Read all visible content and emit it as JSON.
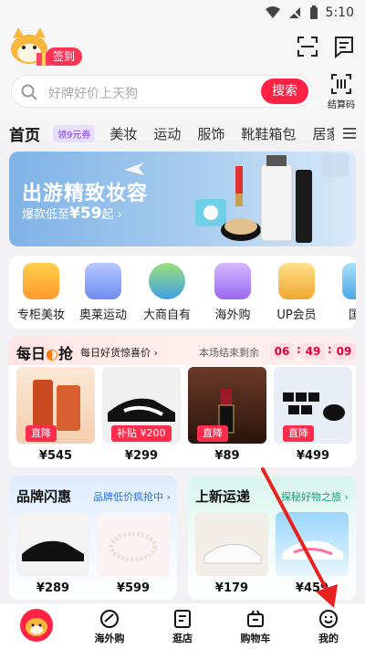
{
  "status": {
    "time": "5:10"
  },
  "header": {
    "signin_label": "签到",
    "search_placeholder": "好牌好价上天狗",
    "search_button": "搜索",
    "paycode_label": "结算码"
  },
  "tabs": {
    "items": [
      "首页",
      "美妆",
      "运动",
      "服饰",
      "靴鞋箱包",
      "居家"
    ],
    "badge": "领9元券"
  },
  "banner": {
    "title": "出游精致妆容",
    "sub_prefix": "爆款低至",
    "sub_price": "¥59",
    "sub_suffix": "起"
  },
  "entries": [
    "专柜美妆",
    "奥莱运动",
    "大商自有",
    "海外购",
    "UP会员",
    "国补"
  ],
  "flash": {
    "title": "每日",
    "title_suffix": "抢",
    "subtitle": "每日好货惊喜价",
    "ends_label": "本场结束剩余",
    "countdown": [
      "06",
      "49",
      "09"
    ],
    "products": [
      {
        "price": "¥545",
        "tag": "直降"
      },
      {
        "price": "¥299",
        "tag": "补贴 ¥200"
      },
      {
        "price": "¥89",
        "tag": "直降"
      },
      {
        "price": "¥499",
        "tag": "直降"
      }
    ]
  },
  "cards": [
    {
      "title": "品牌闪惠",
      "subtitle": "品牌低价疯抢中",
      "prices": [
        "¥289",
        "¥599"
      ]
    },
    {
      "title": "上新运递",
      "subtitle": "探秘好物之旅",
      "prices": [
        "¥179",
        "¥459"
      ]
    }
  ],
  "bottom_nav": [
    "海外购",
    "逛店",
    "购物车",
    "我的"
  ],
  "colors": {
    "brand_red": "#ff2244",
    "accent_purple": "#7a3cf0"
  }
}
